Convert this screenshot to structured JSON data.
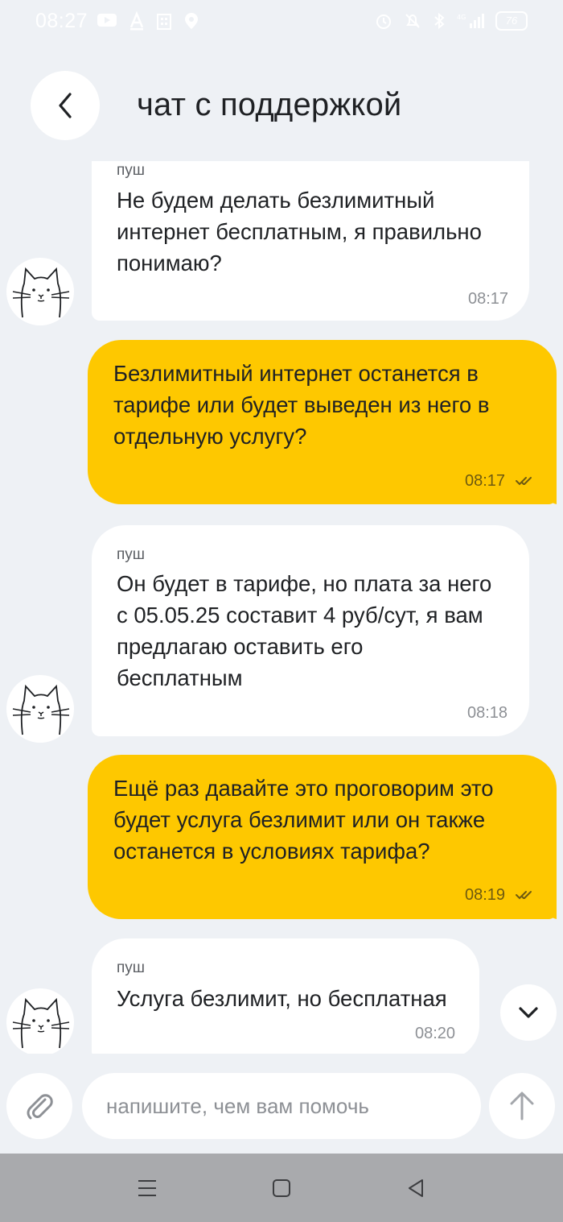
{
  "status_bar": {
    "time": "08:27",
    "battery": "76"
  },
  "header": {
    "title": "чат с поддержкой"
  },
  "messages": [
    {
      "direction": "incoming",
      "sender": "пуш",
      "text_lines": [
        "Не будем делать безлимитный",
        "интернет бесплатным, я правильно",
        "понимаю?"
      ],
      "time": "08:17"
    },
    {
      "direction": "outgoing",
      "text_lines": [
        "Безлимитный интернет останется в",
        "тарифе или будет выведен из него в",
        "отдельную услугу?"
      ],
      "time": "08:17",
      "read": true
    },
    {
      "direction": "incoming",
      "sender": "пуш",
      "text_lines": [
        "Он будет в тарифе, но плата за него",
        "с 05.05.25 составит 4 руб/сут, я вам",
        "предлагаю оставить его",
        "бесплатным"
      ],
      "time": "08:18"
    },
    {
      "direction": "outgoing",
      "text_lines": [
        "Ещё раз давайте это проговорим это",
        "будет услуга безлимит или он также",
        "останется в условиях тарифа?"
      ],
      "time": "08:19",
      "read": true
    },
    {
      "direction": "incoming",
      "sender": "пуш",
      "text_lines": [
        "Услуга безлимит, но бесплатная"
      ],
      "time": "08:20"
    }
  ],
  "composer": {
    "placeholder": "напишите, чем вам помочь"
  },
  "colors": {
    "background": "#eef1f5",
    "outgoing_bubble": "#fec800",
    "incoming_bubble": "#ffffff",
    "nav_bar": "#a9aaad"
  },
  "icons": {
    "back": "chevron-left-icon",
    "scroll_down": "chevron-down-icon",
    "attach": "paperclip-icon",
    "send": "arrow-up-icon",
    "avatar": "cat-icon"
  }
}
